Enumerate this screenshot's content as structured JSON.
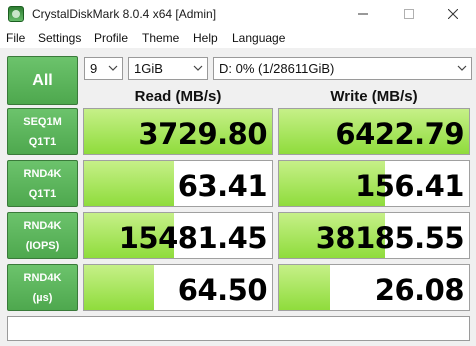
{
  "window": {
    "title": "CrystalDiskMark 8.0.4 x64 [Admin]"
  },
  "menu": [
    "File",
    "Settings",
    "Profile",
    "Theme",
    "Help",
    "Language"
  ],
  "controls": {
    "all_label": "All",
    "count": "9",
    "size": "1GiB",
    "drive": "D: 0% (1/28611GiB)"
  },
  "headers": {
    "read": "Read (MB/s)",
    "write": "Write (MB/s)"
  },
  "rows": [
    {
      "label1": "SEQ1M",
      "label2": "Q1T1",
      "read": "3729.80",
      "write": "6422.79",
      "read_fill": 1.0,
      "write_fill": 1.0
    },
    {
      "label1": "RND4K",
      "label2": "Q1T1",
      "read": "63.41",
      "write": "156.41",
      "read_fill": 0.48,
      "write_fill": 0.56
    },
    {
      "label1": "RND4K",
      "label2": "(IOPS)",
      "read": "15481.45",
      "write": "38185.55",
      "read_fill": 0.48,
      "write_fill": 0.56
    },
    {
      "label1": "RND4K",
      "label2": "(µs)",
      "read": "64.50",
      "write": "26.08",
      "read_fill": 0.37,
      "write_fill": 0.27
    }
  ],
  "comment": "",
  "colors": {
    "accent": "#5cb85c",
    "bar": "#8fdc3c"
  }
}
